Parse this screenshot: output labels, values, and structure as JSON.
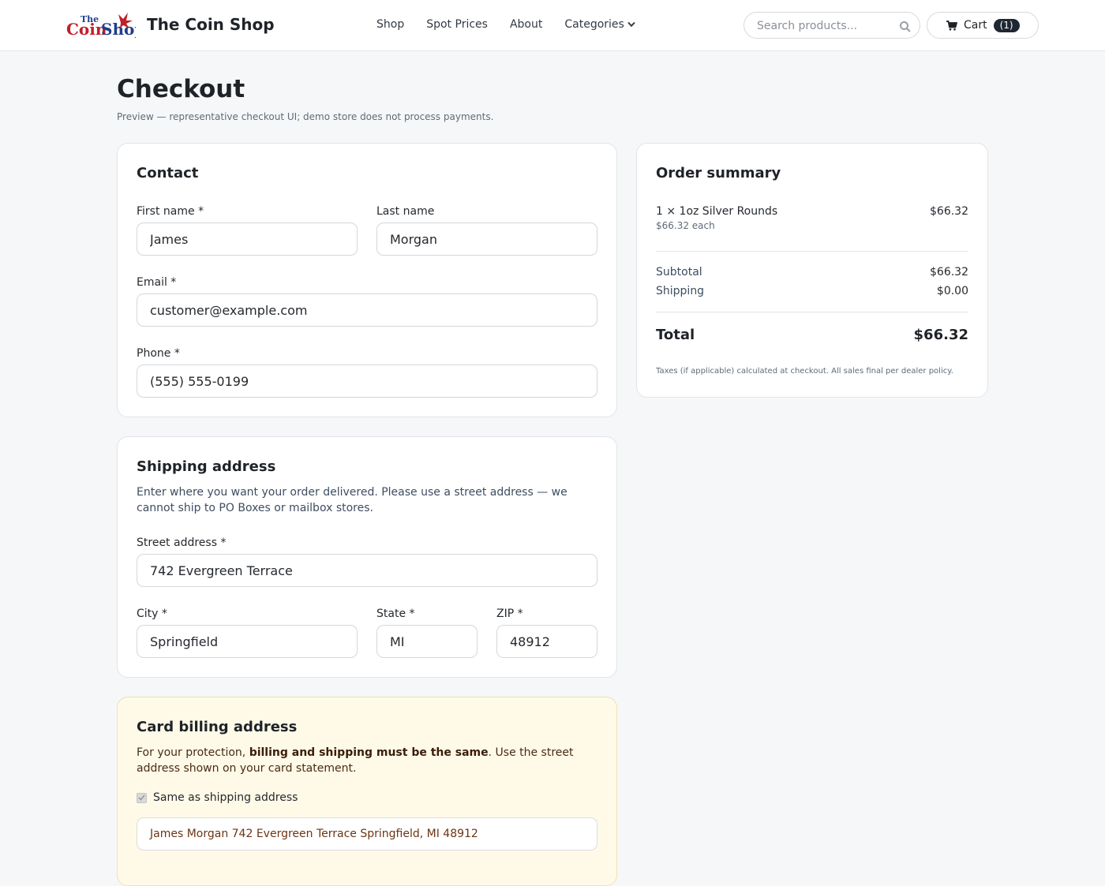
{
  "header": {
    "logo_text": "The Coin Shop",
    "brand": "The Coin Shop",
    "nav": [
      "Shop",
      "Spot Prices",
      "About",
      "Categories"
    ],
    "search_placeholder": "Search products...",
    "cart_label": "Cart",
    "cart_count": "(1)",
    "icons": [
      "search-icon",
      "cart-icon",
      "chevron-down-icon"
    ]
  },
  "page": {
    "title": "Checkout",
    "subtitle": "Preview — representative checkout UI; demo store does not process payments."
  },
  "contact": {
    "heading": "Contact",
    "first_name_label": "First name *",
    "first_name": "James",
    "last_name_label": "Last name",
    "last_name": "Morgan",
    "email_label": "Email *",
    "email": "customer@example.com",
    "phone_label": "Phone *",
    "phone": "(555) 555-0199"
  },
  "shipping": {
    "heading": "Shipping address",
    "description": "Enter where you want your order delivered. Please use a street address — we cannot ship to PO Boxes or mailbox stores.",
    "street_label": "Street address *",
    "street": "742 Evergreen Terrace",
    "city_label": "City *",
    "city": "Springfield",
    "state_label": "State *",
    "state": "MI",
    "zip_label": "ZIP *",
    "zip": "48912"
  },
  "billing": {
    "heading": "Card billing address",
    "desc_prefix": "For your protection, ",
    "desc_bold": "billing and shipping must be the same",
    "desc_suffix": ". Use the street address shown on your card statement.",
    "same_label": "Same as shipping address",
    "same_checked": true,
    "address": "James Morgan 742 Evergreen Terrace Springfield, MI 48912"
  },
  "summary": {
    "heading": "Order summary",
    "item": "1 × 1oz Silver Rounds",
    "item_price": "$66.32",
    "item_each": "$66.32 each",
    "subtotal_label": "Subtotal",
    "subtotal": "$66.32",
    "shipping_label": "Shipping",
    "shipping": "$0.00",
    "total_label": "Total",
    "total": "$66.32",
    "note": "Taxes (if applicable) calculated at checkout. All sales final per dealer policy."
  },
  "colors": {
    "badge_bg": "#1f2733",
    "billing_bg": "#fffae8",
    "logo_red": "#c0202a",
    "logo_blue": "#1f3f8c"
  }
}
